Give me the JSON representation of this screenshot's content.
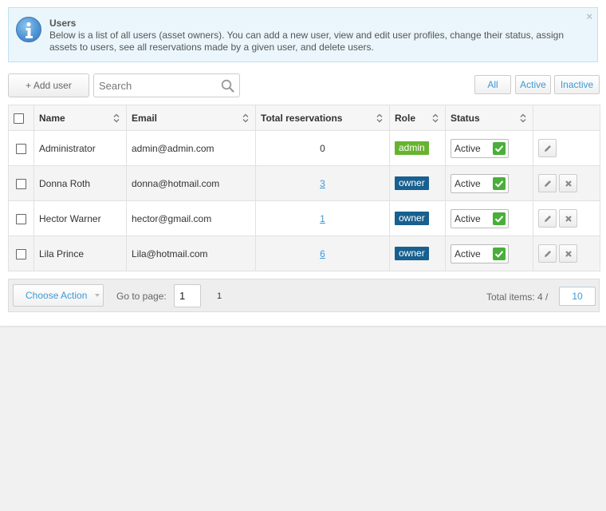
{
  "info": {
    "title": "Users",
    "text": "Below is a list of all users (asset owners). You can add a new user, view and edit user profiles, change their status, assign assets to users, see all reservations made by a given user, and delete users.",
    "close": "×"
  },
  "toolbar": {
    "add_label": "+ Add user",
    "search_placeholder": "Search",
    "filters": {
      "all": "All",
      "active": "Active",
      "inactive": "Inactive"
    }
  },
  "table": {
    "headers": {
      "name": "Name",
      "email": "Email",
      "reservations": "Total reservations",
      "role": "Role",
      "status": "Status"
    },
    "rows": [
      {
        "name": "Administrator",
        "email": "admin@admin.com",
        "reservations": "0",
        "role": "admin",
        "status": "Active"
      },
      {
        "name": "Donna Roth",
        "email": "donna@hotmail.com",
        "reservations": "3",
        "role": "owner",
        "status": "Active"
      },
      {
        "name": "Hector Warner",
        "email": "hector@gmail.com",
        "reservations": "1",
        "role": "owner",
        "status": "Active"
      },
      {
        "name": "Lila Prince",
        "email": "Lila@hotmail.com",
        "reservations": "6",
        "role": "owner",
        "status": "Active"
      }
    ]
  },
  "footer": {
    "choose_action": "Choose Action",
    "goto_label": "Go to page:",
    "page_value": "1",
    "page_number": "1",
    "total_label": "Total items: 4 /",
    "per_page": "10"
  },
  "colors": {
    "link": "#3a9ad9",
    "admin_badge": "#67b32e",
    "owner_badge": "#17608f",
    "status_check": "#4aae3a"
  }
}
